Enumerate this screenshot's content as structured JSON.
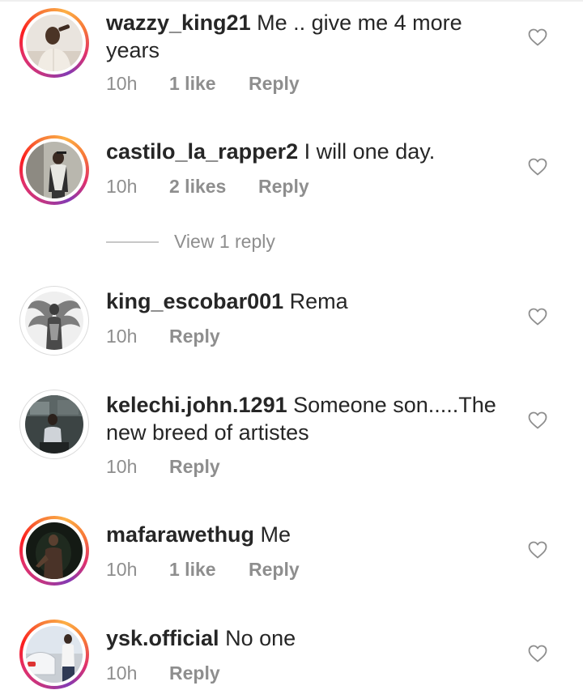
{
  "comments": [
    {
      "username": "wazzy_king21",
      "text": " Me .. give me 4 more years",
      "time": "10h",
      "likes": "1 like",
      "reply": "Reply",
      "avatar": "person-light-shirt-photo",
      "story_ring": true
    },
    {
      "username": "castilo_la_rapper2",
      "text": " I will one day.",
      "time": "10h",
      "likes": "2 likes",
      "reply": "Reply",
      "avatar": "person-cap-photo",
      "story_ring": true,
      "view_replies": "View 1 reply"
    },
    {
      "username": "king_escobar001",
      "text": " Rema",
      "time": "10h",
      "reply": "Reply",
      "avatar": "winged-figure-drawing",
      "story_ring": false
    },
    {
      "username": "kelechi.john.1291",
      "text": " Someone son.....The new breed of artistes",
      "time": "10h",
      "reply": "Reply",
      "avatar": "person-car-photo",
      "story_ring": false
    },
    {
      "username": "mafarawethug",
      "text": " Me",
      "time": "10h",
      "likes": "1 like",
      "reply": "Reply",
      "avatar": "dark-figure-photo",
      "story_ring": true
    },
    {
      "username": "ysk.official",
      "text": " No one",
      "time": "10h",
      "reply": "Reply",
      "avatar": "person-white-car-photo",
      "story_ring": true
    }
  ],
  "colors": {
    "text": "#262626",
    "muted": "#8e8e8e",
    "ring_start": "#fcaf45",
    "ring_end": "#c13584"
  },
  "icons": {
    "like": "heart-outline-icon"
  }
}
